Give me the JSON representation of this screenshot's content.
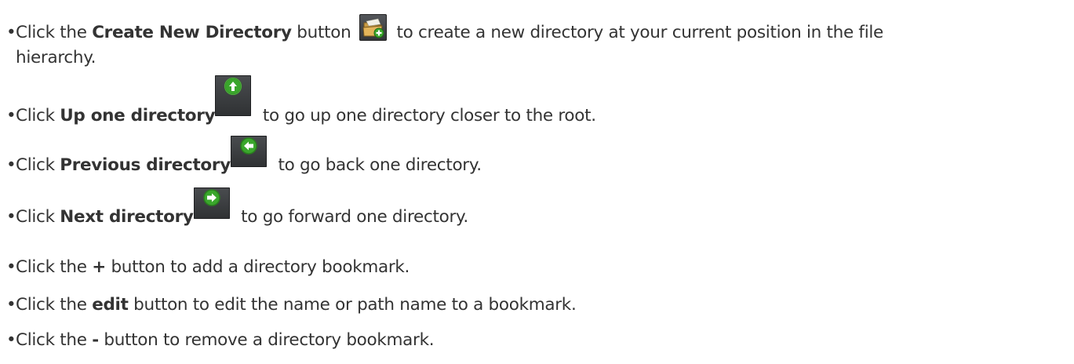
{
  "items": [
    {
      "pre": "Click the ",
      "bold": "Create New Directory",
      "post_a": " button ",
      "post_b": " to create a new directory at your current position in the file",
      "line2": "hierarchy.",
      "icon": "create-folder-icon"
    },
    {
      "pre": "Click ",
      "bold": "Up one directory",
      "post": " to go up one directory closer to the root.",
      "icon": "arrow-up-icon"
    },
    {
      "pre": "Click ",
      "bold": "Previous directory",
      "post": " to go back one directory.",
      "icon": "arrow-left-icon"
    },
    {
      "pre": "Click ",
      "bold": "Next directory",
      "post": " to go forward one directory.",
      "icon": "arrow-right-icon"
    },
    {
      "pre": "Click the ",
      "bold": "+",
      "post": " button to add a directory bookmark."
    },
    {
      "pre": "Click the ",
      "bold": "edit",
      "post": " button to edit the name or path name to a bookmark."
    },
    {
      "pre": "Click the ",
      "bold": "-",
      "post": " button to remove a directory bookmark."
    }
  ],
  "bullet": "•",
  "colors": {
    "text": "#333333",
    "icon_green": "#3aa62c",
    "folder_tan": "#d9a94e"
  }
}
